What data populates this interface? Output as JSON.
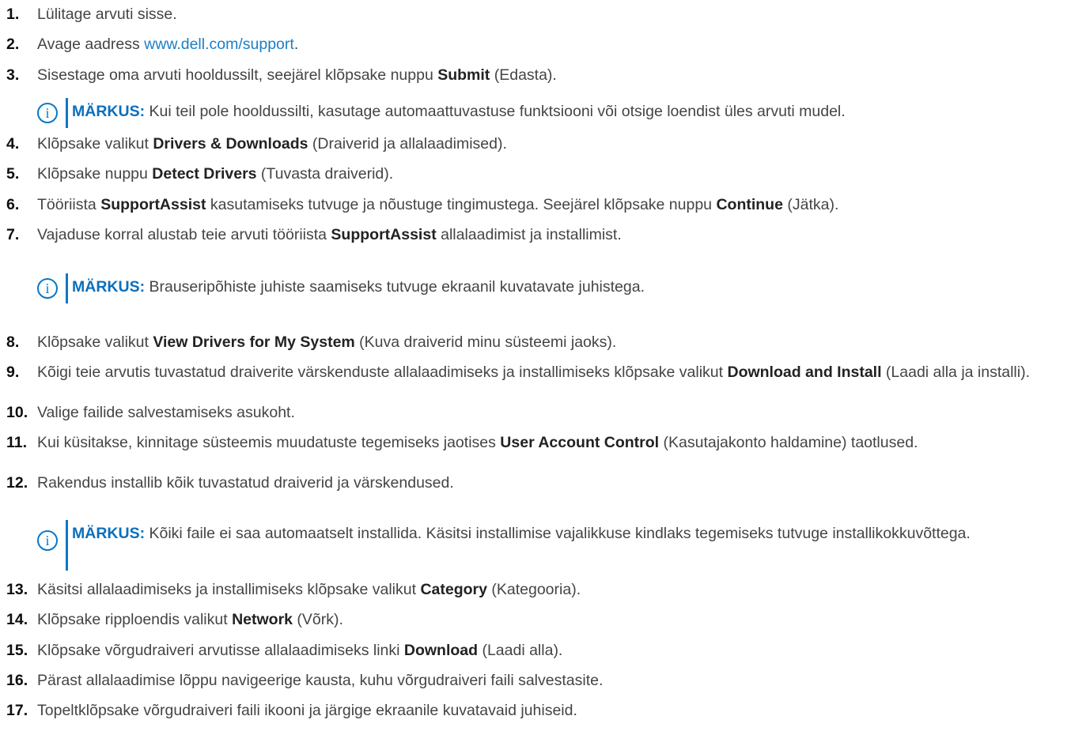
{
  "steps": [
    {
      "num": "1.",
      "parts": [
        {
          "t": "Lülitage arvuti sisse."
        }
      ]
    },
    {
      "num": "2.",
      "parts": [
        {
          "t": "Avage aadress "
        },
        {
          "t": "www.dell.com/support",
          "link": true
        },
        {
          "t": "."
        }
      ]
    },
    {
      "num": "3.",
      "parts": [
        {
          "t": "Sisestage oma arvuti hooldussilt, seejärel klõpsake nuppu "
        },
        {
          "t": "Submit",
          "b": true
        },
        {
          "t": " (Edasta)."
        }
      ]
    },
    {
      "num": "4.",
      "parts": [
        {
          "t": "Klõpsake valikut "
        },
        {
          "t": "Drivers & Downloads",
          "b": true
        },
        {
          "t": " (Draiverid ja allalaadimised)."
        }
      ]
    },
    {
      "num": "5.",
      "parts": [
        {
          "t": "Klõpsake nuppu "
        },
        {
          "t": "Detect Drivers",
          "b": true
        },
        {
          "t": " (Tuvasta draiverid)."
        }
      ]
    },
    {
      "num": "6.",
      "parts": [
        {
          "t": "Tööriista "
        },
        {
          "t": "SupportAssist",
          "b": true
        },
        {
          "t": " kasutamiseks tutvuge ja nõustuge tingimustega. Seejärel klõpsake nuppu "
        },
        {
          "t": "Continue",
          "b": true
        },
        {
          "t": " (Jätka)."
        }
      ]
    },
    {
      "num": "7.",
      "parts": [
        {
          "t": "Vajaduse korral alustab teie arvuti tööriista "
        },
        {
          "t": "SupportAssist",
          "b": true
        },
        {
          "t": " allalaadimist ja installimist."
        }
      ]
    },
    {
      "num": "8.",
      "parts": [
        {
          "t": "Klõpsake valikut "
        },
        {
          "t": "View Drivers for My System",
          "b": true
        },
        {
          "t": " (Kuva draiverid minu süsteemi jaoks)."
        }
      ]
    },
    {
      "num": "9.",
      "parts": [
        {
          "t": "Kõigi teie arvutis tuvastatud draiverite värskenduste allalaadimiseks ja installimiseks klõpsake valikut "
        },
        {
          "t": "Download and Install",
          "b": true
        },
        {
          "t": " (Laadi alla ja installi)."
        }
      ]
    },
    {
      "num": "10.",
      "parts": [
        {
          "t": "Valige failide salvestamiseks asukoht."
        }
      ]
    },
    {
      "num": "11.",
      "parts": [
        {
          "t": "Kui küsitakse, kinnitage süsteemis muudatuste tegemiseks jaotises "
        },
        {
          "t": "User Account Control",
          "b": true
        },
        {
          "t": " (Kasutajakonto haldamine) taotlused."
        }
      ]
    },
    {
      "num": "12.",
      "parts": [
        {
          "t": "Rakendus installib kõik tuvastatud draiverid ja värskendused."
        }
      ]
    },
    {
      "num": "13.",
      "parts": [
        {
          "t": "Käsitsi allalaadimiseks ja installimiseks klõpsake valikut "
        },
        {
          "t": "Category",
          "b": true
        },
        {
          "t": " (Kategooria)."
        }
      ]
    },
    {
      "num": "14.",
      "parts": [
        {
          "t": "Klõpsake ripploendis valikut "
        },
        {
          "t": "Network",
          "b": true
        },
        {
          "t": " (Võrk)."
        }
      ]
    },
    {
      "num": "15.",
      "parts": [
        {
          "t": "Klõpsake võrgudraiveri arvutisse allalaadimiseks linki "
        },
        {
          "t": "Download",
          "b": true
        },
        {
          "t": " (Laadi alla)."
        }
      ]
    },
    {
      "num": "16.",
      "parts": [
        {
          "t": "Pärast allalaadimise lõppu navigeerige kausta, kuhu võrgudraiveri faili salvestasite."
        }
      ]
    },
    {
      "num": "17.",
      "parts": [
        {
          "t": "Topeltklõpsake võrgudraiveri faili ikooni ja järgige ekraanile kuvatavaid juhiseid."
        }
      ]
    }
  ],
  "notes": [
    {
      "label": "MÄRKUS:",
      "text": " Kui teil pole hooldussilti, kasutage automaattuvastuse funktsiooni või otsige loendist üles arvuti mudel."
    },
    {
      "label": "MÄRKUS:",
      "text": " Brauseripõhiste juhiste saamiseks tutvuge ekraanil kuvatavate juhistega."
    },
    {
      "label": "MÄRKUS:",
      "text": " Kõiki faile ei saa automaatselt installida. Käsitsi installimise vajalikkuse kindlaks tegemiseks tutvuge installikokkuvõttega."
    }
  ],
  "note_icon": "info-icon",
  "colors": {
    "accent": "#0a78c8",
    "link": "#1b7fc4",
    "text": "#444444"
  }
}
